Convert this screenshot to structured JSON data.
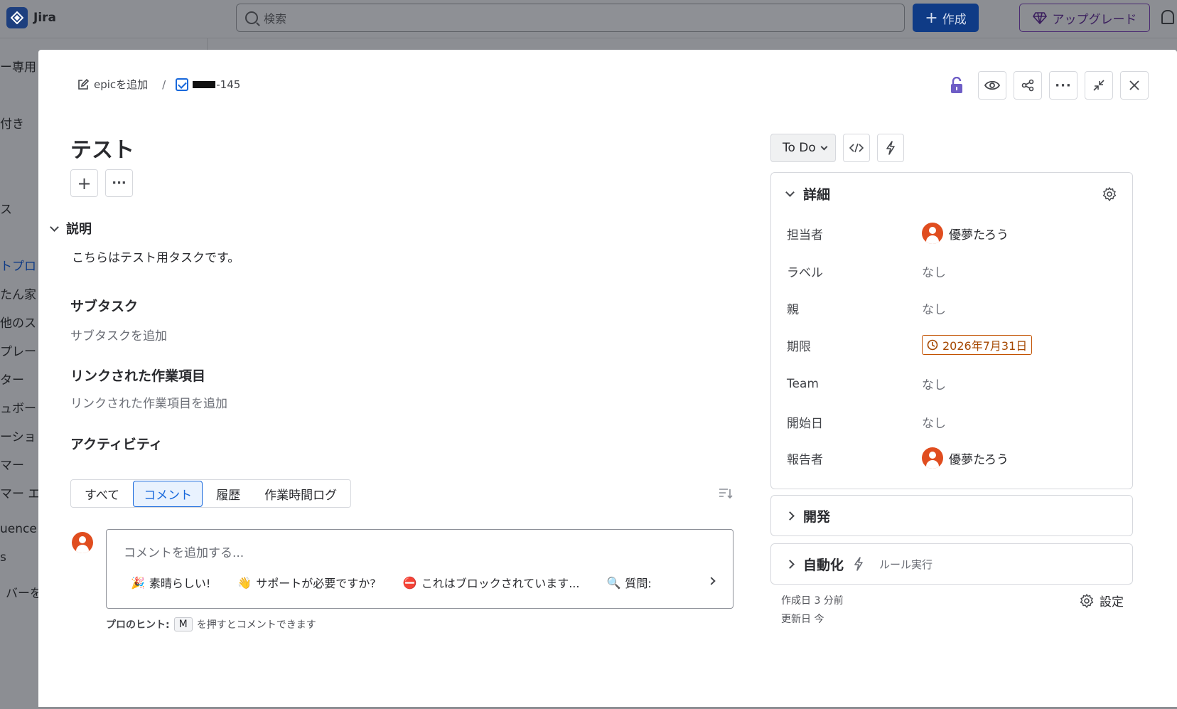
{
  "app": {
    "name": "Jira",
    "search_placeholder": "検索",
    "create_label": "作成",
    "upgrade_label": "アップグレード"
  },
  "sidebar_fragments": [
    "ー専用",
    "付き",
    "ス",
    "トプロ",
    "たん家",
    "他のス",
    "プレー",
    "ター",
    "ュボー",
    "ーショ",
    "マー",
    "マー エ",
    "uence",
    "s",
    "バーを"
  ],
  "breadcrumb": {
    "add_epic": "epicを追加",
    "separator": "/",
    "issue_key_suffix": "-145"
  },
  "issue": {
    "title": "テスト",
    "description_heading": "説明",
    "description": "こちらはテスト用タスクです。",
    "subtasks_heading": "サブタスク",
    "subtasks_add": "サブタスクを追加",
    "linked_heading": "リンクされた作業項目",
    "linked_add": "リンクされた作業項目を追加",
    "activity_heading": "アクティビティ"
  },
  "activity_tabs": [
    {
      "label": "すべて",
      "active": false
    },
    {
      "label": "コメント",
      "active": true
    },
    {
      "label": "履歴",
      "active": false
    },
    {
      "label": "作業時間ログ",
      "active": false
    }
  ],
  "comment": {
    "placeholder": "コメントを追加する...",
    "quick_replies": [
      {
        "emoji": "🎉",
        "label": "素晴らしい!"
      },
      {
        "emoji": "👋",
        "label": "サポートが必要ですか?"
      },
      {
        "emoji": "⛔",
        "label": "これはブロックされています..."
      },
      {
        "emoji": "🔍",
        "label": "質問:"
      }
    ],
    "tip_label": "プロのヒント:",
    "tip_key": "M",
    "tip_text": "を押すとコメントできます"
  },
  "status": {
    "label": "To Do"
  },
  "details": {
    "heading": "詳細",
    "fields": [
      {
        "label": "担当者",
        "value": "優夢たろう",
        "type": "person"
      },
      {
        "label": "ラベル",
        "value": "なし",
        "type": "text"
      },
      {
        "label": "親",
        "value": "なし",
        "type": "text"
      },
      {
        "label": "期限",
        "value": "2026年7月31日",
        "type": "due"
      },
      {
        "label": "Team",
        "value": "なし",
        "type": "text"
      },
      {
        "label": "開始日",
        "value": "なし",
        "type": "text"
      },
      {
        "label": "報告者",
        "value": "優夢たろう",
        "type": "person"
      }
    ]
  },
  "development": {
    "heading": "開発"
  },
  "automation": {
    "heading": "自動化",
    "sub": "ルール実行"
  },
  "meta": {
    "created": "作成日 3 分前",
    "updated": "更新日 今"
  },
  "settings_label": "設定",
  "colors": {
    "accent": "#1868db",
    "avatar": "#e04d1f",
    "due": "#c25100",
    "lock": "#6e5dc6"
  }
}
